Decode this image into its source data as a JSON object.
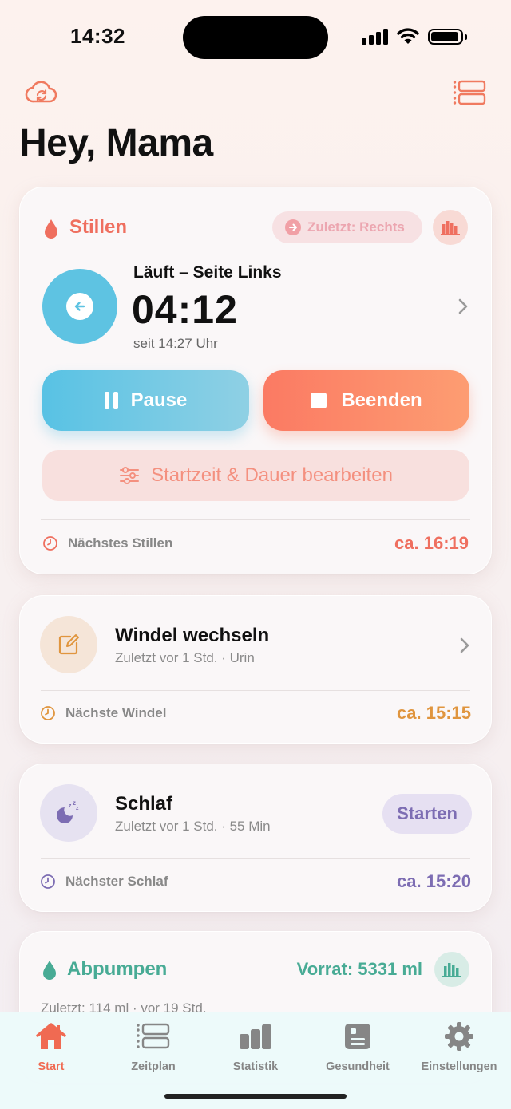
{
  "status_bar": {
    "time": "14:32"
  },
  "header": {
    "greeting": "Hey, Mama"
  },
  "nursing": {
    "title": "Stillen",
    "last_chip": "Zuletzt: Rechts",
    "running_label": "Läuft – Seite Links",
    "timer": "04:12",
    "since": "seit 14:27 Uhr",
    "pause_label": "Pause",
    "end_label": "Beenden",
    "edit_label": "Startzeit & Dauer bearbeiten",
    "next_label": "Nächstes Stillen",
    "next_value": "ca. 16:19",
    "accent": "#ef6f5f"
  },
  "diaper": {
    "title": "Windel wechseln",
    "subtitle": "Zuletzt vor 1 Std. · Urin",
    "next_label": "Nächste Windel",
    "next_value": "ca. 15:15",
    "accent": "#e0953e",
    "icon": "edit-note-icon"
  },
  "sleep": {
    "title": "Schlaf",
    "subtitle": "Zuletzt vor 1 Std. · 55 Min",
    "start_label": "Starten",
    "next_label": "Nächster Schlaf",
    "next_value": "ca. 15:20",
    "accent": "#7d6db3",
    "icon": "moon-zzz-icon"
  },
  "pumping": {
    "title": "Abpumpen",
    "stock": "Vorrat: 5331 ml",
    "subtitle": "Zuletzt: 114 ml · vor 19 Std.",
    "accent": "#48ab95"
  },
  "tab_bar": {
    "active_color": "#f06a52",
    "items": [
      {
        "label": "Start",
        "icon": "house-icon",
        "active": true
      },
      {
        "label": "Zeitplan",
        "icon": "schedule-icon",
        "active": false
      },
      {
        "label": "Statistik",
        "icon": "bar-chart-icon",
        "active": false
      },
      {
        "label": "Gesundheit",
        "icon": "health-record-icon",
        "active": false
      },
      {
        "label": "Einstellungen",
        "icon": "gear-icon",
        "active": false
      }
    ]
  }
}
